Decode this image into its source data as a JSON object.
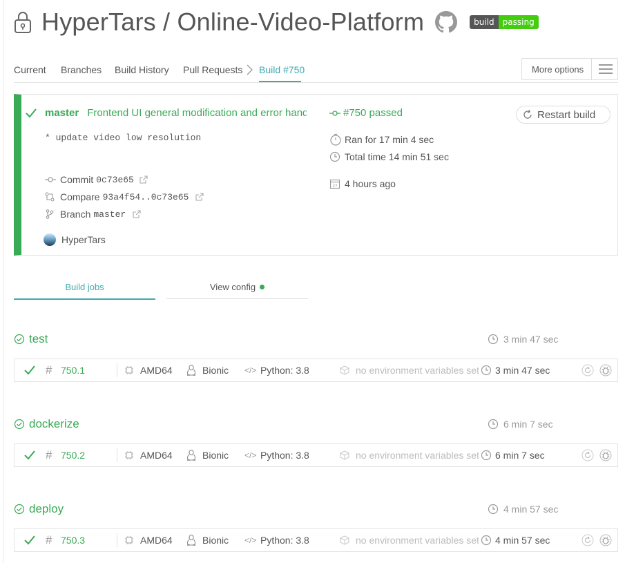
{
  "repo": {
    "title": "HyperTars / Online-Video-Platform",
    "badge_left": "build",
    "badge_right": "passing"
  },
  "tabs": {
    "current": "Current",
    "branches": "Branches",
    "history": "Build History",
    "pull_requests": "Pull Requests",
    "build": "Build #750",
    "more_options": "More options"
  },
  "build": {
    "branch": "master",
    "message_title": "Frontend UI general modification and error handling",
    "message_body": "* update video low resolution",
    "status": "#750 passed",
    "ran_for": "Ran for 17 min 4 sec",
    "total_time": "Total time 14 min 51 sec",
    "ago": "4 hours ago",
    "restart_label": "Restart build",
    "commit_label": "Commit",
    "commit_hash": "0c73e65",
    "compare_label": "Compare",
    "compare_range": "93a4f54..0c73e65",
    "branch_label": "Branch",
    "branch_name": "master",
    "author": "HyperTars"
  },
  "subtabs": {
    "jobs": "Build jobs",
    "config": "View config"
  },
  "stages": [
    {
      "name": "test",
      "time": "3 min 47 sec",
      "job": {
        "number": "750.1",
        "arch": "AMD64",
        "dist": "Bionic",
        "lang": "Python: 3.8",
        "env": "no environment variables set",
        "duration": "3 min 47 sec"
      }
    },
    {
      "name": "dockerize",
      "time": "6 min 7 sec",
      "job": {
        "number": "750.2",
        "arch": "AMD64",
        "dist": "Bionic",
        "lang": "Python: 3.8",
        "env": "no environment variables set",
        "duration": "6 min 7 sec"
      }
    },
    {
      "name": "deploy",
      "time": "4 min 57 sec",
      "job": {
        "number": "750.3",
        "arch": "AMD64",
        "dist": "Bionic",
        "lang": "Python: 3.8",
        "env": "no environment variables set",
        "duration": "4 min 57 sec"
      }
    }
  ],
  "colors": {
    "passed": "#39aa56",
    "accent": "#3eaaaf",
    "badge_dark": "#555555",
    "badge_green": "#44cc11"
  }
}
